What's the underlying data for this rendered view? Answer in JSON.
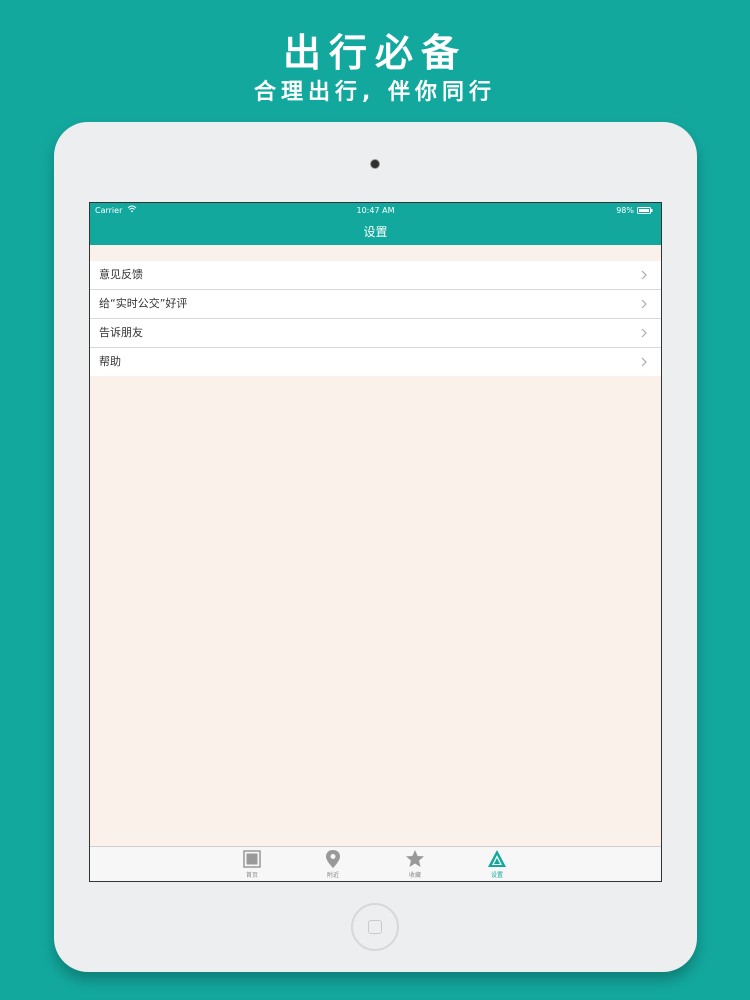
{
  "promo": {
    "title": "出行必备",
    "subtitle": "合理出行, 伴你同行"
  },
  "status_bar": {
    "carrier": "Carrier",
    "time": "10:47 AM",
    "battery": "98%"
  },
  "nav": {
    "title": "设置"
  },
  "settings": {
    "items": [
      {
        "label": "意见反馈"
      },
      {
        "label": "给“实时公交”好评"
      },
      {
        "label": "告诉朋友"
      },
      {
        "label": "帮助"
      }
    ]
  },
  "tab_bar": {
    "tabs": [
      {
        "label": "首页",
        "icon": "home-square-icon"
      },
      {
        "label": "附近",
        "icon": "location-pin-icon"
      },
      {
        "label": "收藏",
        "icon": "star-icon"
      },
      {
        "label": "设置",
        "icon": "triangle-settings-icon"
      }
    ],
    "active_tab": "设置"
  },
  "colors": {
    "brand": "#13a89e",
    "content_background": "#faf1eb"
  }
}
